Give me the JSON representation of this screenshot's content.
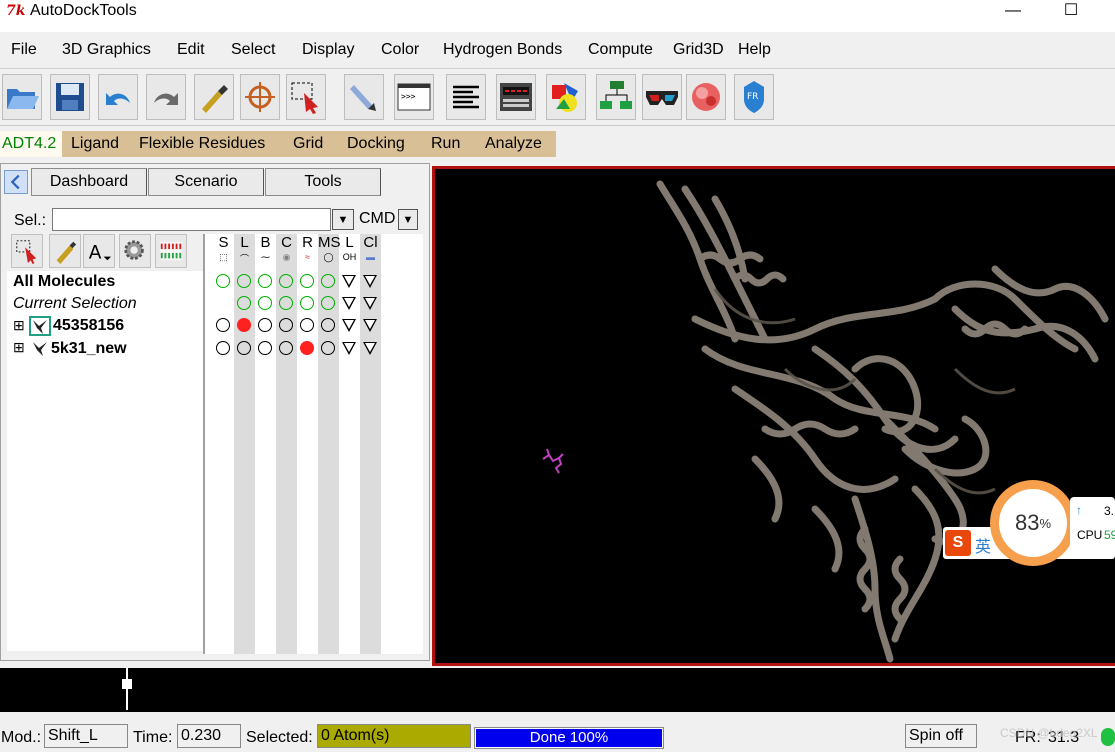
{
  "window": {
    "title": "AutoDockTools",
    "app_icon": "7k",
    "minimize_glyph": "—",
    "maximize_glyph": "☐"
  },
  "menubar": {
    "items": [
      "File",
      "3D Graphics",
      "Edit",
      "Select",
      "Display",
      "Color",
      "Hydrogen Bonds",
      "Compute",
      "Grid3D",
      "Help"
    ]
  },
  "toolbar": {
    "icons": [
      "open-folder-icon",
      "save-icon",
      "undo-arrow-icon",
      "redo-arrow-icon",
      "pick-icon",
      "crosshair-center-icon",
      "select-dashed-icon",
      "bond-pen-icon",
      "python-shell-icon",
      "text-align-icon",
      "lcd-display-icon",
      "shapes-icon",
      "flowchart-icon",
      "3d-glasses-icon",
      "molecule-surface-icon",
      "fr-logo-icon"
    ]
  },
  "adt_tabs": {
    "active": "ADT4.2",
    "items": [
      "Ligand",
      "Flexible Residues",
      "Grid",
      "Docking",
      "Run",
      "Analyze"
    ]
  },
  "dashboard": {
    "tabs": [
      "Dashboard",
      "Scenario",
      "Tools"
    ],
    "sel_label": "Sel.:",
    "sel_value": "",
    "cmd_label": "CMD",
    "dropdown_glyph": "▼",
    "columns": [
      {
        "label": "S",
        "sub": "⬚"
      },
      {
        "label": "L",
        "sub": "⌒"
      },
      {
        "label": "B",
        "sub": "⁓"
      },
      {
        "label": "C",
        "sub": "◉"
      },
      {
        "label": "R",
        "sub": "≈"
      },
      {
        "label": "MS",
        "sub": "◯"
      },
      {
        "label": "L",
        "sub": "OH"
      },
      {
        "label": "Cl",
        "sub": "▬"
      }
    ],
    "tree": [
      {
        "label": "All Molecules",
        "style": "bold"
      },
      {
        "label": "Current Selection",
        "style": "italic"
      },
      {
        "label": "45358156",
        "style": "bold",
        "expand": "⊞"
      },
      {
        "label": "5k31_new",
        "style": "bold",
        "expand": "⊞"
      }
    ]
  },
  "statusbar": {
    "mod_label": "Mod.:",
    "mod_value": "Shift_L",
    "time_label": "Time:",
    "time_value": "0.230",
    "selected_label": "Selected:",
    "selected_value": "0 Atom(s)",
    "progress_text": "Done 100%",
    "progress": 1.0,
    "spin_label": "Spin off",
    "fr_label": "FR:",
    "fr_value": "31.3",
    "watermark": "CSDN @bdeg2XL"
  },
  "overlay": {
    "percent": "83",
    "percent_sign": "%",
    "cpu_label": "CPU",
    "cpu_value": "59",
    "net_value": "3.",
    "ime_label": "英"
  },
  "colors": {
    "viewer_bg": "#000000",
    "viewer_border": "#b01010",
    "tab_strip": "#d9bf96",
    "selected_field": "#aaaa00",
    "progress": "#0000ee"
  }
}
